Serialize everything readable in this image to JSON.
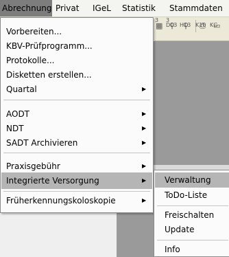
{
  "menubar": {
    "items": [
      {
        "label": "Abrechnung"
      },
      {
        "label": "Privat"
      },
      {
        "label": "IGeL"
      },
      {
        "label": "Statistik"
      },
      {
        "label": "Stammdaten"
      }
    ]
  },
  "toolbar": {
    "codes": [
      "D13",
      "H13",
      "K10",
      "KG"
    ],
    "codes_top": [
      "3",
      "3"
    ]
  },
  "menu": {
    "items": [
      {
        "label": "Vorbereiten...",
        "submenu": false
      },
      {
        "label": "KBV-Prüfprogramm...",
        "submenu": false
      },
      {
        "label": "Protokolle...",
        "submenu": false
      },
      {
        "label": "Disketten erstellen...",
        "submenu": false
      },
      {
        "label": "Quartal",
        "submenu": true
      },
      {
        "label": "AODT",
        "submenu": true
      },
      {
        "label": "NDT",
        "submenu": true
      },
      {
        "label": "SADT Archivieren",
        "submenu": true
      },
      {
        "label": "Praxisgebühr",
        "submenu": true
      },
      {
        "label": "Integrierte Versorgung",
        "submenu": true
      },
      {
        "label": "Früherkennungskoloskopie",
        "submenu": true
      }
    ]
  },
  "submenu": {
    "items": [
      {
        "label": "Verwaltung"
      },
      {
        "label": "ToDo-Liste"
      },
      {
        "label": "Freischalten"
      },
      {
        "label": "Update"
      },
      {
        "label": "Info"
      }
    ]
  }
}
